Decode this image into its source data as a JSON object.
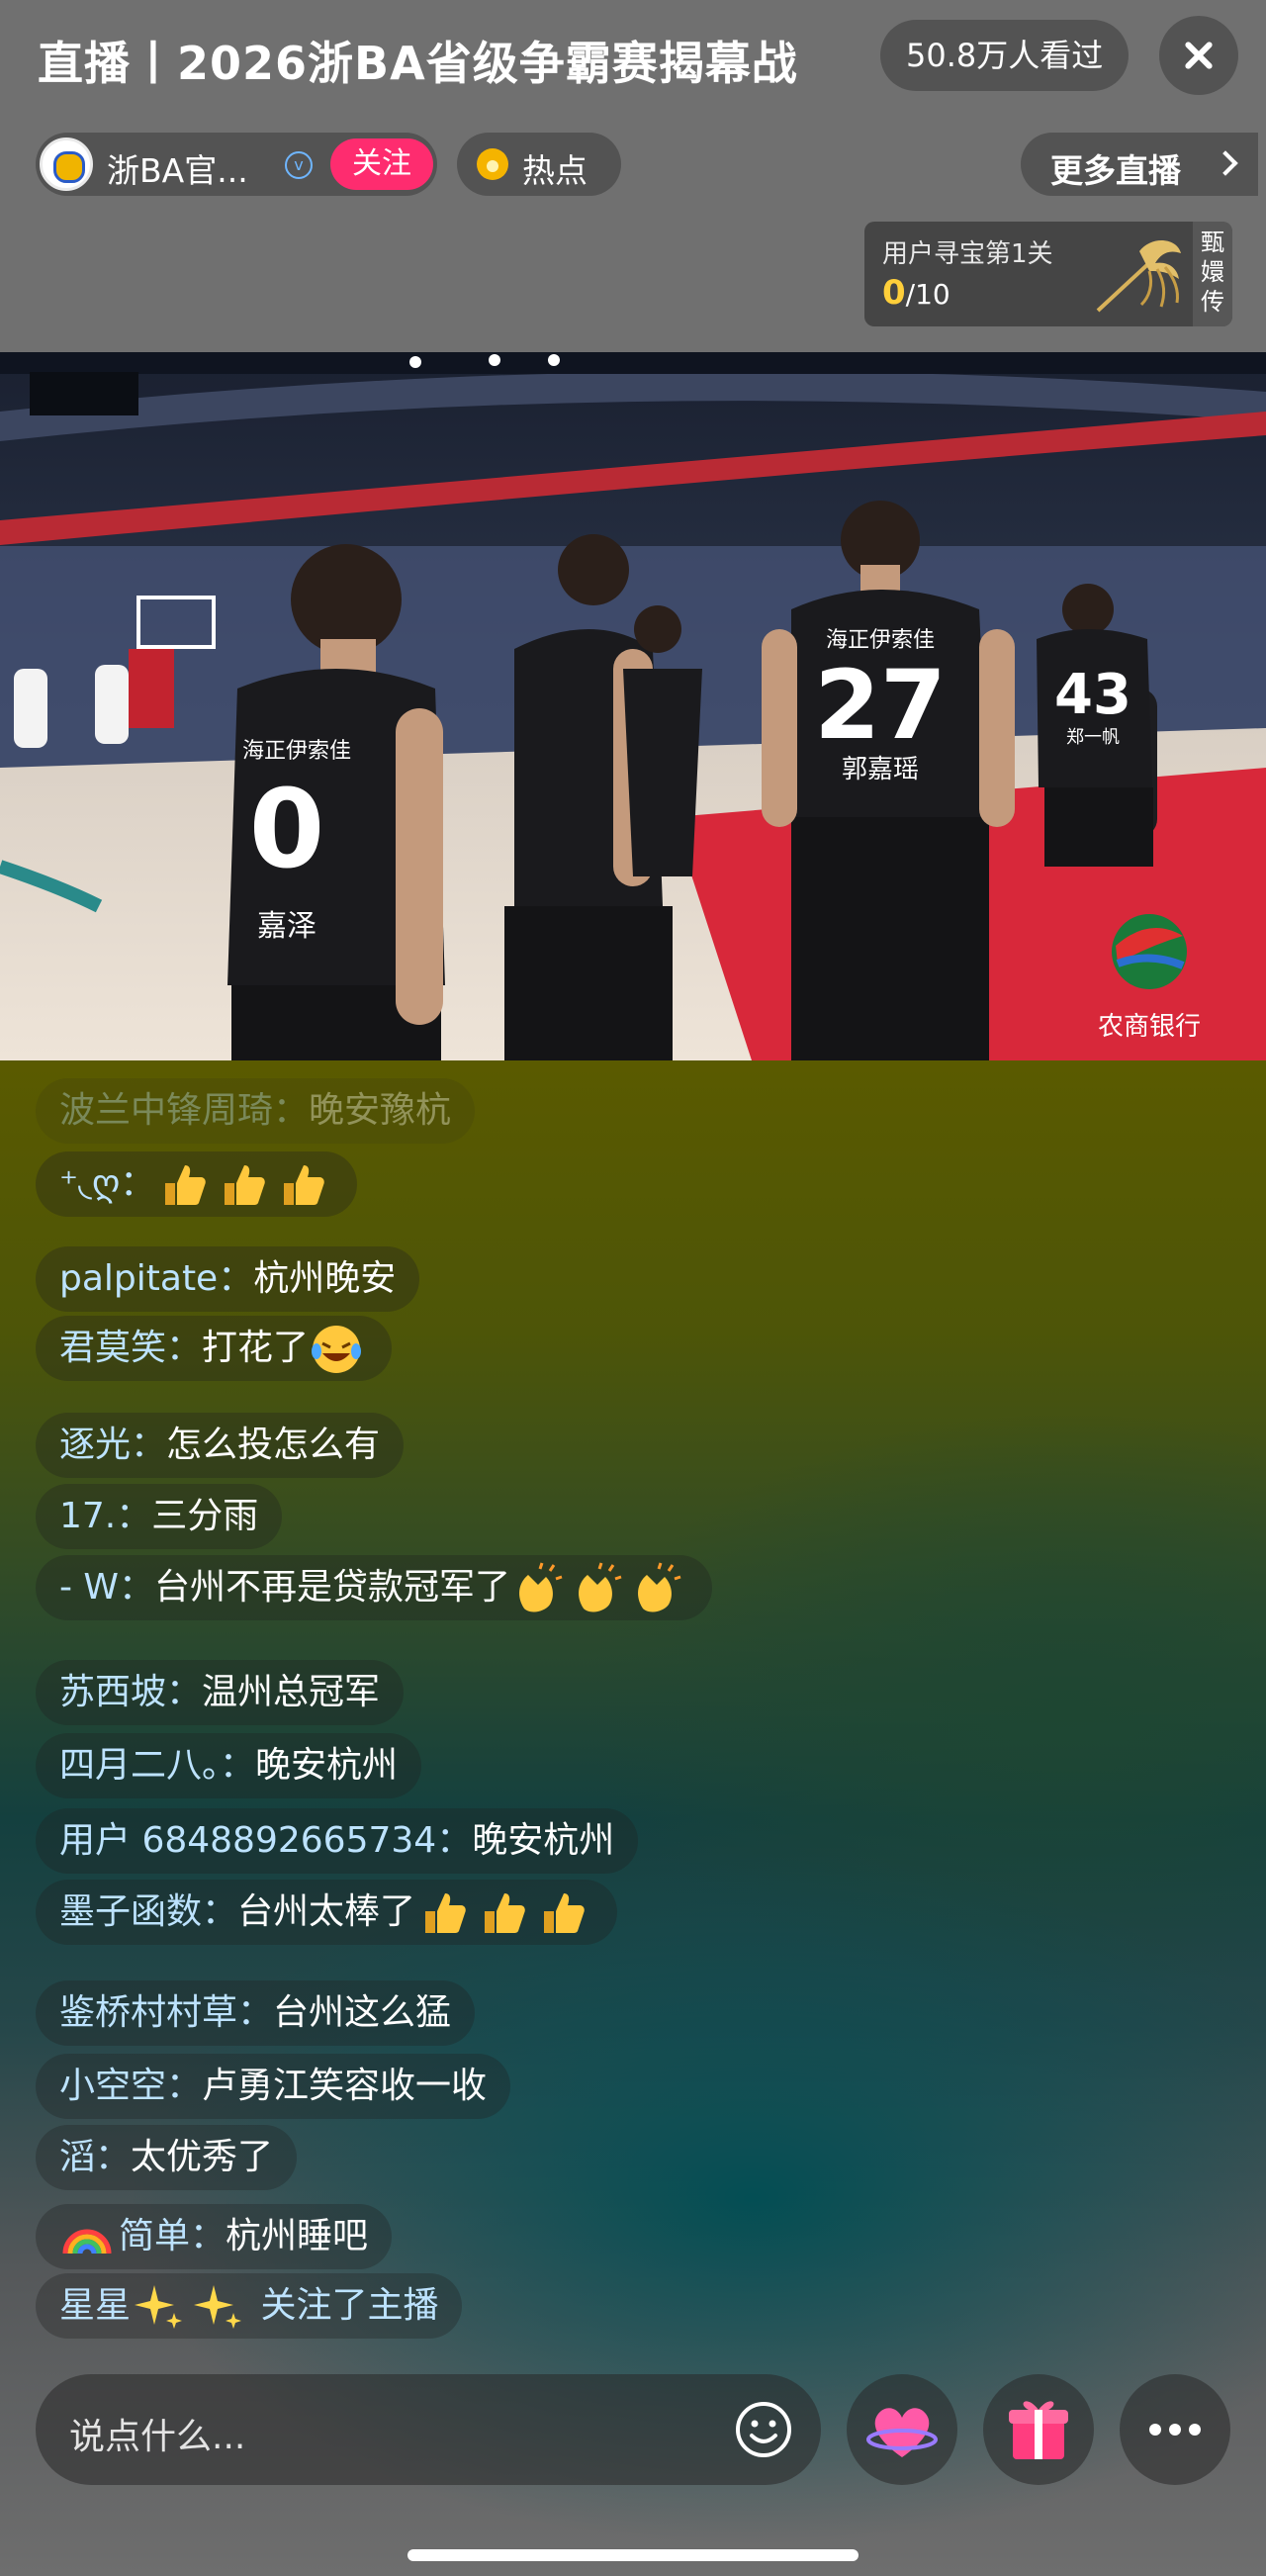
{
  "header": {
    "title": "直播丨2026浙BA省级争霸赛揭幕战",
    "viewers": "50.8万人看过"
  },
  "streamer": {
    "name": "浙BA官...",
    "verified_mark": "v",
    "follow_label": "关注"
  },
  "hot_label": "热点",
  "more_live_label": "更多直播",
  "treasure": {
    "title": "用户寻宝第1关",
    "current": "0",
    "total": "/10",
    "side_label": [
      "甄",
      "嬛",
      "传"
    ]
  },
  "video": {
    "player_numbers": [
      "0",
      "27",
      "43"
    ],
    "player_names": [
      "嘉泽",
      "郭嘉瑶",
      "郑一帆"
    ],
    "sponsor_text": "海正伊索佳",
    "bank_logo_text": "农商银行"
  },
  "chat": {
    "messages": [
      {
        "user": "波兰中锋周琦：",
        "text": "晚安豫杭",
        "emojis": [],
        "faded": true
      },
      {
        "user": "⁺◟ღ：",
        "text": "",
        "emojis": [
          "thumbs-up-icon",
          "thumbs-up-icon",
          "thumbs-up-icon"
        ]
      },
      {
        "user": "palpitate：",
        "text": "杭州晚安",
        "emojis": []
      },
      {
        "user": "君莫笑：",
        "text": "打花了",
        "emojis": [
          "laughing-crying-icon"
        ]
      },
      {
        "user": "逐光：",
        "text": "怎么投怎么有",
        "emojis": []
      },
      {
        "user": "17.：",
        "text": "三分雨",
        "emojis": []
      },
      {
        "user": "- W：",
        "text": "台州不再是贷款冠军了",
        "emojis": [
          "clapping-hands-icon",
          "clapping-hands-icon",
          "clapping-hands-icon"
        ]
      },
      {
        "user": "苏西坡：",
        "text": "温州总冠军",
        "emojis": []
      },
      {
        "user": "四月二八。：",
        "text": "晚安杭州",
        "emojis": []
      },
      {
        "user": "用户 6848892665734：",
        "text": "晚安杭州",
        "emojis": []
      },
      {
        "user": "墨子函数：",
        "text": "台州太棒了",
        "emojis": [
          "thumbs-up-icon",
          "thumbs-up-icon",
          "thumbs-up-icon"
        ]
      },
      {
        "user": "鉴桥村村草：",
        "text": "台州这么猛",
        "emojis": []
      },
      {
        "user": "小空空：",
        "text": "卢勇江笑容收一收",
        "emojis": []
      },
      {
        "user": "滔：",
        "text": "太优秀了",
        "emojis": []
      },
      {
        "user": "简单：",
        "text": "杭州睡吧",
        "emojis": [
          "rainbow-icon"
        ],
        "emoji_before": true
      },
      {
        "user": "星星",
        "text": "",
        "emojis": [
          "sparkles-icon",
          "sparkles-icon"
        ],
        "suffix": " 关注了主播",
        "system": true
      }
    ]
  },
  "bottom": {
    "placeholder": "说点什么..."
  },
  "colors": {
    "follow_pink": "#fe2c6f",
    "username_blue": "#bde3ff",
    "treasure_gold": "#ffcf3a",
    "court_red": "#d8283a"
  }
}
